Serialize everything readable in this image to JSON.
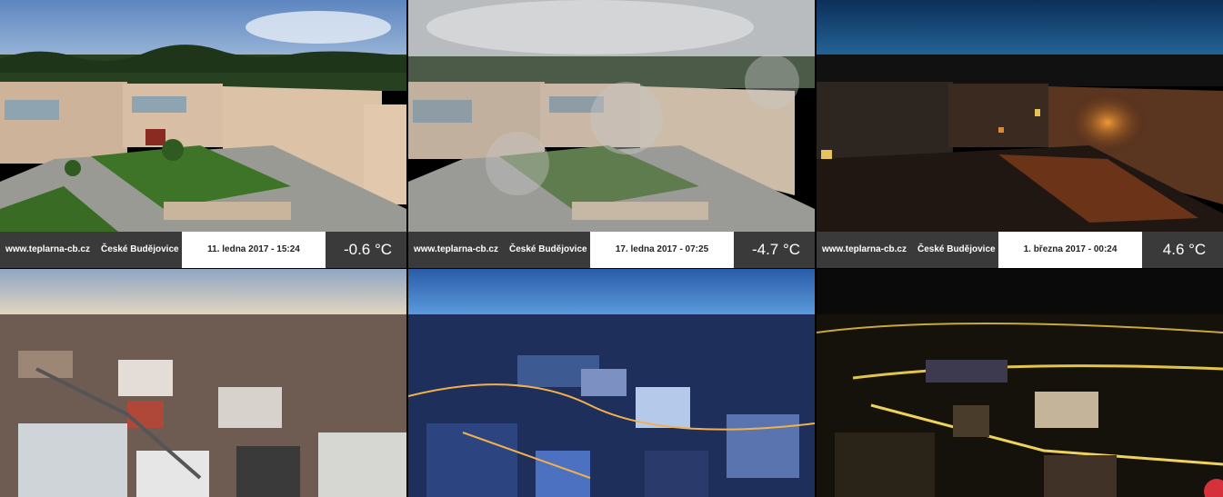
{
  "watermark": {
    "site": "www.teplarna-cb.cz",
    "city": "České Budějovice"
  },
  "panels": [
    {
      "scene": "courtyard-day",
      "date": "11. ledna 2017 - 15:24",
      "temp": "-0.6 °C"
    },
    {
      "scene": "courtyard-fog",
      "date": "17. ledna 2017 - 07:25",
      "temp": "-4.7 °C"
    },
    {
      "scene": "courtyard-night",
      "date": "1. března 2017 - 00:24",
      "temp": "4.6 °C"
    },
    {
      "scene": "city-dusk"
    },
    {
      "scene": "city-blue-hour"
    },
    {
      "scene": "city-night"
    }
  ]
}
